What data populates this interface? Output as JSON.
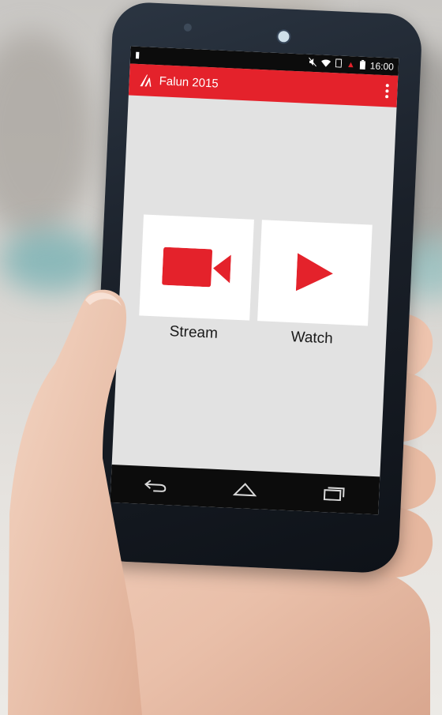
{
  "status_bar": {
    "time": "16:00"
  },
  "app_bar": {
    "title": "Falun 2015",
    "logo_icon": "app-logo-icon",
    "menu_icon": "overflow-menu-icon",
    "color": "#e4222b"
  },
  "actions": [
    {
      "label": "Stream",
      "icon": "video-camera-icon"
    },
    {
      "label": "Watch",
      "icon": "play-icon"
    }
  ],
  "navigation": {
    "back_icon": "back-icon",
    "home_icon": "home-icon",
    "recents_icon": "recent-apps-icon"
  },
  "colors": {
    "accent": "#e4222b",
    "screen_background": "#e2e2e2",
    "card": "#ffffff"
  }
}
